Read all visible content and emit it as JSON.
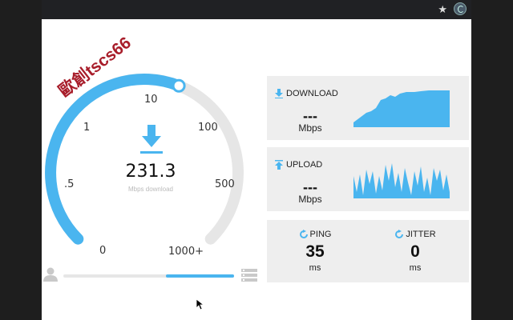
{
  "watermark": "歐創tscs66",
  "gauge": {
    "value": "231.3",
    "unit_label": "Mbps download",
    "fill_fraction": 0.58,
    "ticks": [
      "0",
      ".5",
      "1",
      "10",
      "100",
      "500",
      "1000+"
    ]
  },
  "progress": {
    "fraction": 0.4
  },
  "download": {
    "label": "DOWNLOAD",
    "value": "---",
    "unit": "Mbps"
  },
  "upload": {
    "label": "UPLOAD",
    "value": "---",
    "unit": "Mbps"
  },
  "ping": {
    "label": "PING",
    "value": "35",
    "unit": "ms"
  },
  "jitter": {
    "label": "JITTER",
    "value": "0",
    "unit": "ms"
  },
  "colors": {
    "accent": "#4ab5ef",
    "track": "#e6e6e6",
    "card": "#eeeeee",
    "watermark": "#a81d2a"
  },
  "icons": [
    "star-icon",
    "extension-icon",
    "download-arrow-icon",
    "upload-arrow-icon",
    "refresh-icon",
    "avatar-icon",
    "server-icon",
    "cursor-icon"
  ]
}
